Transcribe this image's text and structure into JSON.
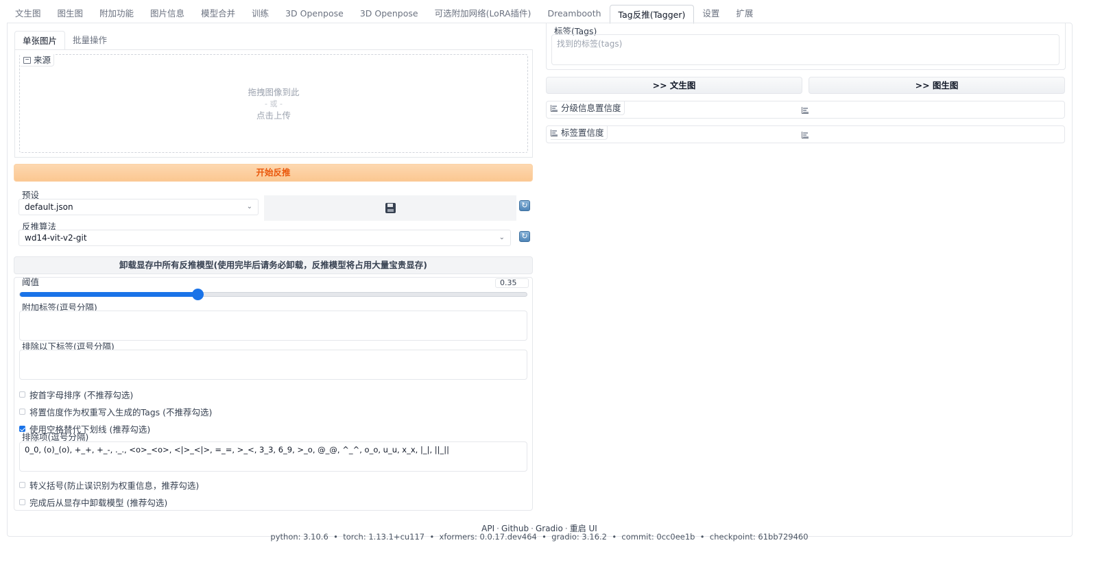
{
  "tabs": [
    {
      "label": "文生图"
    },
    {
      "label": "图生图"
    },
    {
      "label": "附加功能"
    },
    {
      "label": "图片信息"
    },
    {
      "label": "模型合并"
    },
    {
      "label": "训练"
    },
    {
      "label": "3D Openpose"
    },
    {
      "label": "3D Openpose"
    },
    {
      "label": "可选附加网络(LoRA插件)"
    },
    {
      "label": "Dreambooth"
    },
    {
      "label": "Tag反推(Tagger)"
    },
    {
      "label": "设置"
    },
    {
      "label": "扩展"
    }
  ],
  "active_tab": "Tag反推(Tagger)",
  "left": {
    "subtabs": [
      {
        "label": "单张图片"
      },
      {
        "label": "批量操作"
      }
    ],
    "image": {
      "label": "来源",
      "drop_text": "拖拽图像到此",
      "or_text": "- 或 -",
      "click_text": "点击上传"
    },
    "start_button": "开始反推",
    "preset": {
      "label": "预设",
      "value": "default.json"
    },
    "interrogator": {
      "label": "反推算法",
      "value": "wd14-vit-v2-git"
    },
    "unload_button": "卸载显存中所有反推模型(使用完毕后请务必卸载，反推模型将占用大量宝贵显存)",
    "threshold": {
      "label": "阈值",
      "value": 0.35,
      "display": "0.35",
      "min": 0,
      "max": 1
    },
    "additional_tags": {
      "label": "附加标签(逗号分隔)",
      "value": ""
    },
    "exclude_tags": {
      "label": "排除以下标签(逗号分隔)",
      "value": ""
    },
    "checkboxes": [
      {
        "label": "按首字母排序 (不推荐勾选)",
        "checked": false
      },
      {
        "label": "将置信度作为权重写入生成的Tags (不推荐勾选)",
        "checked": false
      },
      {
        "label": "使用空格替代下划线 (推荐勾选)",
        "checked": true
      }
    ],
    "exclusions": {
      "label": "排除项(逗号分隔)",
      "value": "0_0, (o)_(o), +_+, +_-, ._., <o>_<o>, <|>_<|>, =_=, >_<, 3_3, 6_9, >_o, @_@, ^_^, o_o, u_u, x_x, |_|, ||_||"
    },
    "checkboxes_bottom": [
      {
        "label": "转义括号(防止误识别为权重信息，推荐勾选)",
        "checked": false
      },
      {
        "label": "完成后从显存中卸载模型 (推荐勾选)",
        "checked": false
      }
    ]
  },
  "right": {
    "tags": {
      "label": "标签(Tags)",
      "placeholder": "找到的标签(tags)"
    },
    "to_txt2img": ">> 文生图",
    "to_img2img": ">> 图生图",
    "rating_confidence": "分级信息置信度",
    "tag_confidence": "标签置信度"
  },
  "footer": {
    "links": [
      "API",
      "Github",
      "Gradio",
      "重启 UI"
    ],
    "separator": "•",
    "versions": [
      "python: 3.10.6",
      "torch: 1.13.1+cu117",
      "xformers: 0.0.17.dev464",
      "gradio: 3.16.2",
      "commit: 0cc0ee1b",
      "checkpoint: 61bb729460"
    ]
  },
  "colors": {
    "accent": "#1a73e8",
    "primary_button_text": "#ea580c",
    "primary_button_bg": "#fbc791"
  },
  "icons": {
    "image": "image-icon",
    "save": "floppy-disk-icon",
    "refresh": "refresh-icon",
    "confidence": "bar-chart-icon",
    "dropdown": "chevron-down-icon"
  }
}
